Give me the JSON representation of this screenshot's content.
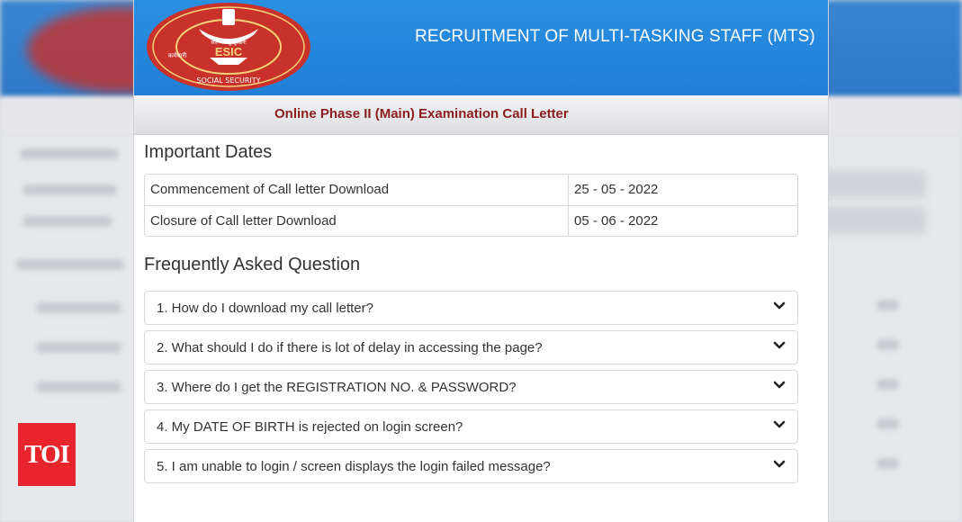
{
  "header": {
    "title": "RECRUITMENT OF MULTI-TASKING STAFF (MTS)",
    "logo_text": "ESIC",
    "logo_left_text": "कर्मचारी",
    "logo_right_text": "SOCIAL SECURITY",
    "logo_top_text": "सर्वे भवन्तु सुखिनः"
  },
  "subheader": {
    "title": "Online Phase II (Main) Examination Call Letter"
  },
  "important_dates": {
    "heading": "Important Dates",
    "rows": [
      {
        "label": "Commencement of Call letter Download",
        "value": "25 - 05 - 2022"
      },
      {
        "label": "Closure of Call letter Download",
        "value": "05 - 06 - 2022"
      }
    ]
  },
  "faq": {
    "heading": "Frequently Asked Question",
    "items": [
      "1. How do I download my call letter?",
      "2. What should I do if there is lot of delay in accessing the page?",
      "3. Where do I get the REGISTRATION NO. & PASSWORD?",
      "4. My DATE OF BIRTH is rejected on login screen?",
      "5. I am unable to login / screen displays the login failed message?"
    ]
  },
  "badge": {
    "text": "TOI"
  },
  "colors": {
    "header_blue": "#2b8fe0",
    "subtitle_maroon": "#8b1e1e",
    "logo_red": "#c8322b",
    "badge_red": "#e8242c"
  }
}
